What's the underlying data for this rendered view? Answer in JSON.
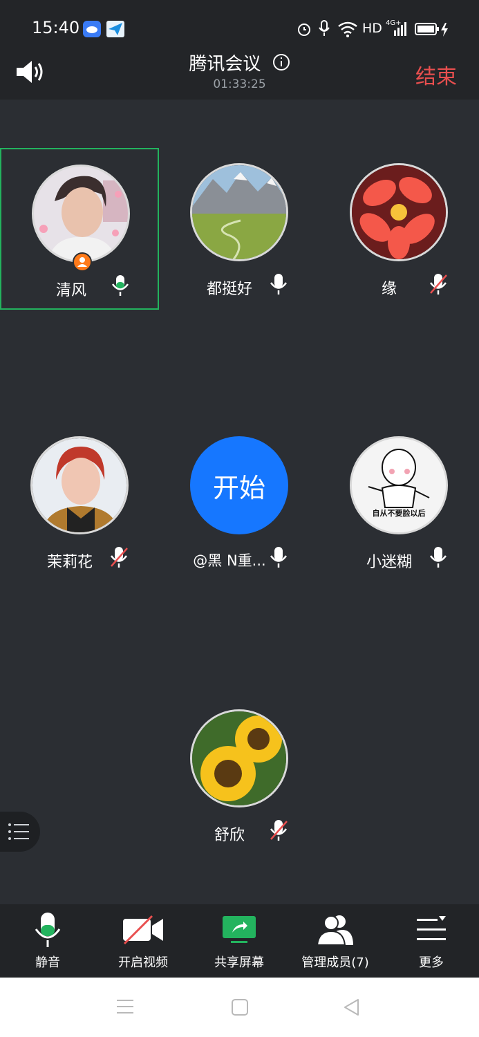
{
  "status_bar": {
    "time": "15:40",
    "hd": "HD",
    "network": "4G+"
  },
  "header": {
    "title": "腾讯会议",
    "duration": "01:33:25",
    "end_label": "结束"
  },
  "participants": [
    {
      "name": "清风",
      "mic": "speaking",
      "active": true,
      "host": true,
      "avatar": "portrait-woman-1"
    },
    {
      "name": "都挺好",
      "mic": "on",
      "avatar": "mountain-valley"
    },
    {
      "name": "缘",
      "mic": "muted",
      "avatar": "red-flower"
    },
    {
      "name": "茉莉花",
      "mic": "muted",
      "avatar": "portrait-woman-2"
    },
    {
      "name": "@黑 N重...",
      "mic": "on",
      "avatar_text": "开始",
      "avatar": "blue-circle"
    },
    {
      "name": "小迷糊",
      "mic": "on",
      "avatar": "meme-sticker",
      "avatar_caption": "自从不要脸以后"
    },
    {
      "name": "舒欣",
      "mic": "muted",
      "avatar": "sunflowers"
    }
  ],
  "toolbar": {
    "mute_label": "静音",
    "video_label": "开启视频",
    "share_label": "共享屏幕",
    "members_label": "管理成员(7)",
    "more_label": "更多"
  },
  "colors": {
    "accent_green": "#23b35e",
    "end_red": "#e94f4f",
    "blue": "#1677ff"
  }
}
